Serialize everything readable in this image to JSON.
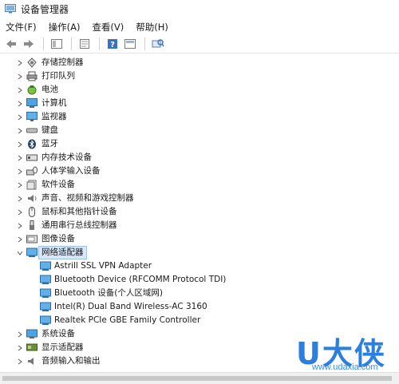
{
  "window": {
    "title": "设备管理器"
  },
  "menu": [
    {
      "label": "文件(F)"
    },
    {
      "label": "操作(A)"
    },
    {
      "label": "查看(V)"
    },
    {
      "label": "帮助(H)"
    }
  ],
  "toolbar": {
    "buttons": [
      "back-icon",
      "forward-icon",
      "properties-panel-icon",
      "update-driver-icon",
      "help-icon",
      "display-icon",
      "scan-hardware-icon"
    ]
  },
  "tree": {
    "categories": [
      {
        "label": "存储控制器",
        "icon": "storage-controller-icon",
        "expanded": false
      },
      {
        "label": "打印队列",
        "icon": "printer-icon",
        "expanded": false
      },
      {
        "label": "电池",
        "icon": "battery-icon",
        "expanded": false
      },
      {
        "label": "计算机",
        "icon": "computer-icon",
        "expanded": false
      },
      {
        "label": "监视器",
        "icon": "monitor-icon",
        "expanded": false
      },
      {
        "label": "键盘",
        "icon": "keyboard-icon",
        "expanded": false
      },
      {
        "label": "蓝牙",
        "icon": "bluetooth-icon",
        "expanded": false
      },
      {
        "label": "内存技术设备",
        "icon": "memory-device-icon",
        "expanded": false
      },
      {
        "label": "人体学输入设备",
        "icon": "hid-icon",
        "expanded": false
      },
      {
        "label": "软件设备",
        "icon": "software-device-icon",
        "expanded": false
      },
      {
        "label": "声音、视频和游戏控制器",
        "icon": "sound-icon",
        "expanded": false
      },
      {
        "label": "鼠标和其他指针设备",
        "icon": "mouse-icon",
        "expanded": false
      },
      {
        "label": "通用串行总线控制器",
        "icon": "usb-icon",
        "expanded": false
      },
      {
        "label": "图像设备",
        "icon": "imaging-device-icon",
        "expanded": false
      },
      {
        "label": "网络适配器",
        "icon": "network-adapter-icon",
        "expanded": true,
        "selected": true,
        "children": [
          {
            "label": "Astrill SSL VPN Adapter"
          },
          {
            "label": "Bluetooth Device (RFCOMM Protocol TDI)"
          },
          {
            "label": "Bluetooth 设备(个人区域网)"
          },
          {
            "label": "Intel(R) Dual Band Wireless-AC 3160"
          },
          {
            "label": "Realtek PCIe GBE Family Controller"
          }
        ]
      },
      {
        "label": "系统设备",
        "icon": "system-device-icon",
        "expanded": false
      },
      {
        "label": "显示适配器",
        "icon": "display-adapter-icon",
        "expanded": false
      },
      {
        "label": "音频输入和输出",
        "icon": "audio-io-icon",
        "expanded": false
      }
    ]
  },
  "watermark": {
    "logo": "U大侠",
    "url": "www.udaxia.com"
  }
}
